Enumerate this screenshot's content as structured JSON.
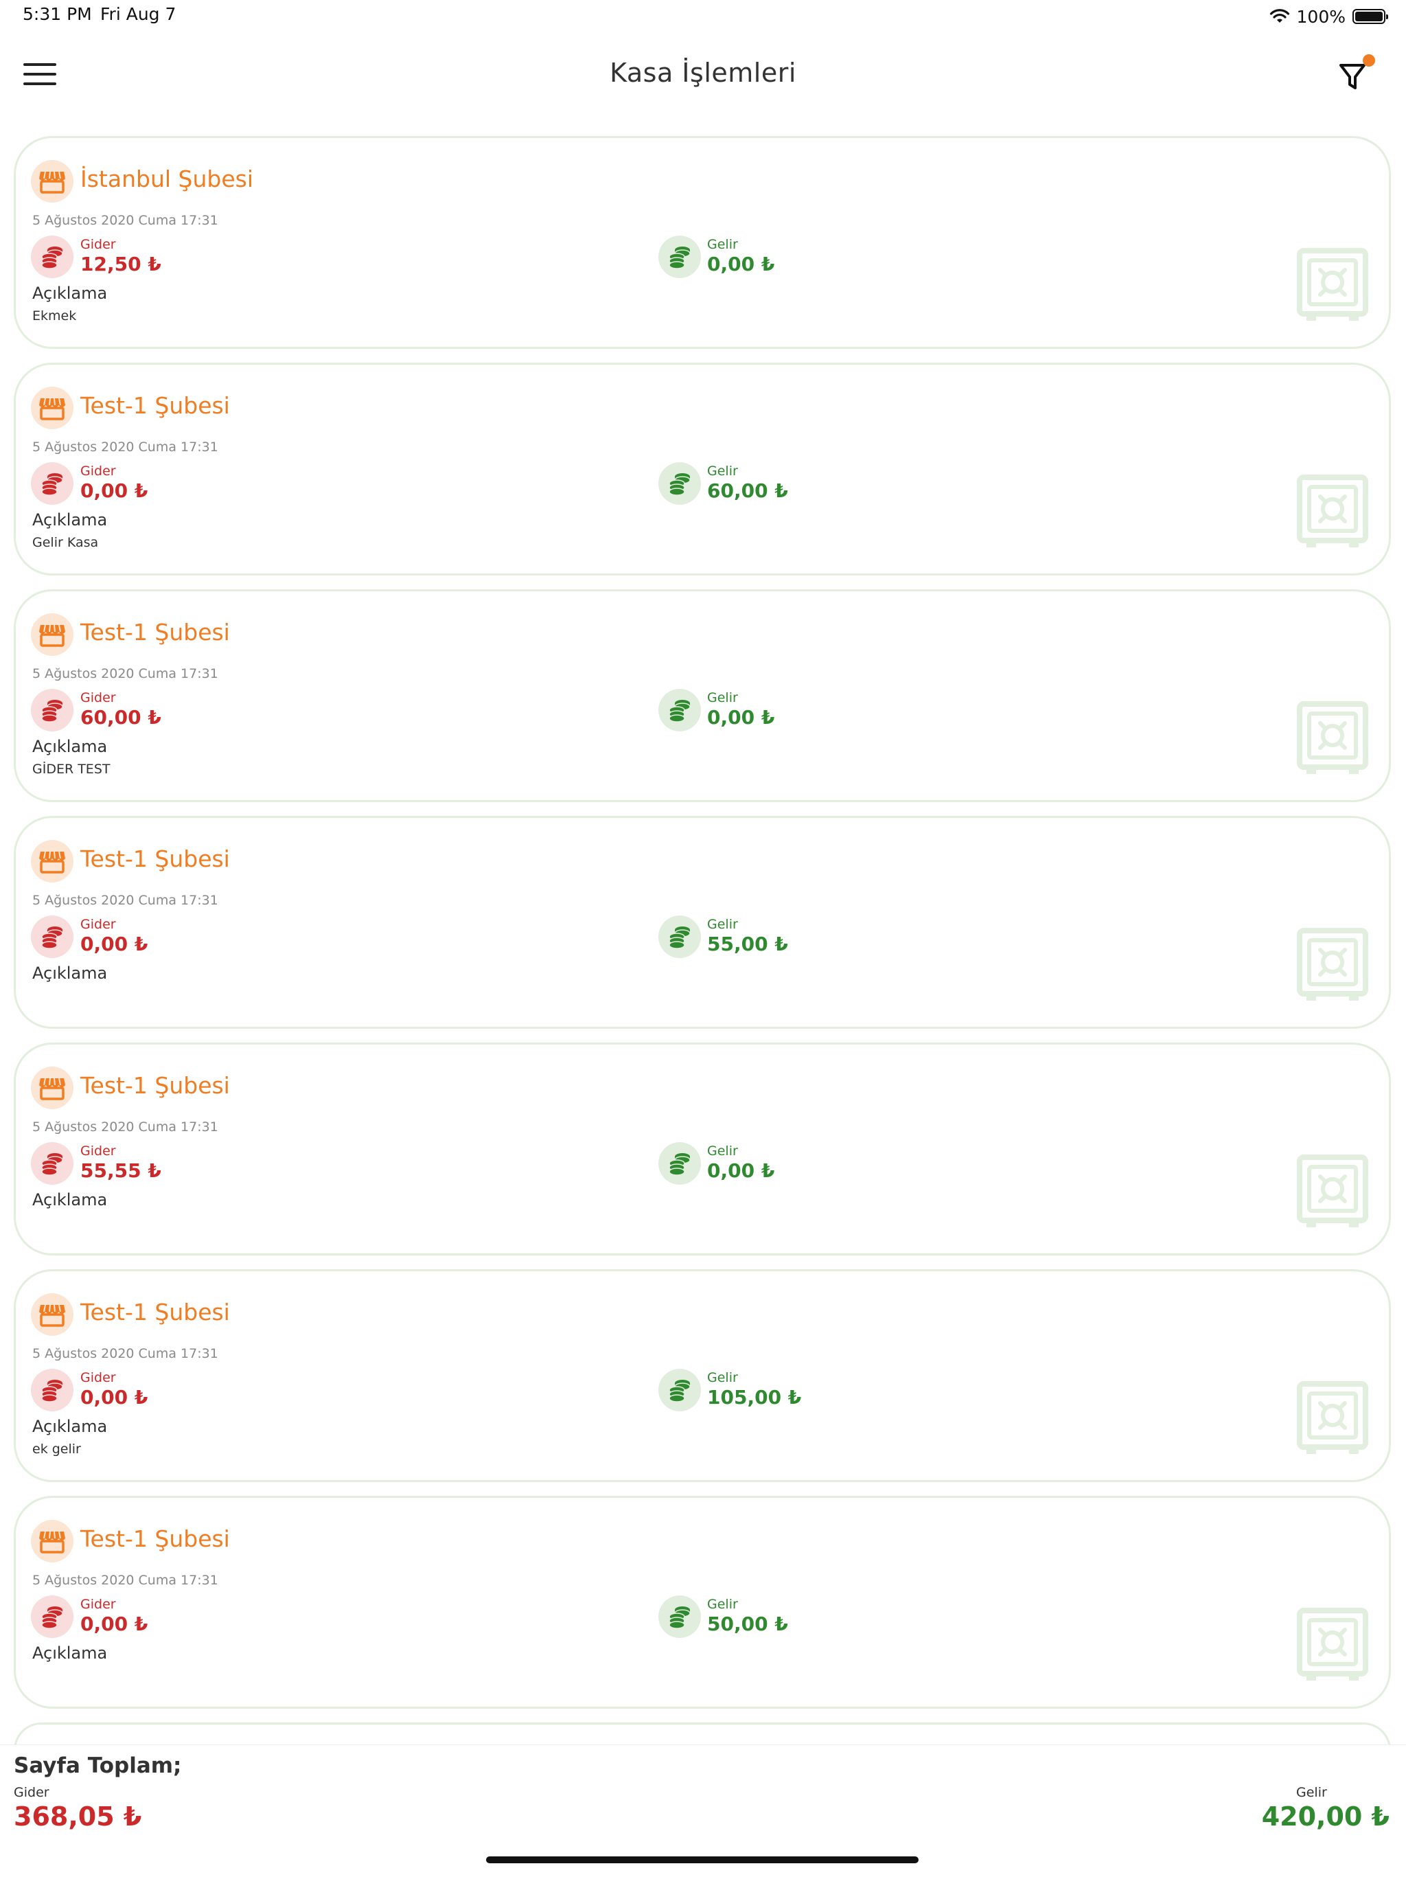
{
  "status_bar": {
    "time": "5:31 PM",
    "date": "Fri Aug 7",
    "battery": "100%"
  },
  "header": {
    "title": "Kasa İşlemleri"
  },
  "colors": {
    "accent": "#f07d22",
    "expense": "#cc2a2a",
    "income": "#2f8a2f",
    "card_border": "#e2efdf"
  },
  "records": [
    {
      "branch": "İstanbul Şubesi",
      "date": "5 Ağustos 2020 Cuma 17:31",
      "gider_label": "Gider",
      "gider": "12,50 ₺",
      "gelir_label": "Gelir",
      "gelir": "0,00 ₺",
      "desc_label": "Açıklama",
      "desc": "Ekmek"
    },
    {
      "branch": "Test-1 Şubesi",
      "date": "5 Ağustos 2020 Cuma 17:31",
      "gider_label": "Gider",
      "gider": "0,00 ₺",
      "gelir_label": "Gelir",
      "gelir": "60,00 ₺",
      "desc_label": "Açıklama",
      "desc": "Gelir Kasa"
    },
    {
      "branch": "Test-1 Şubesi",
      "date": "5 Ağustos 2020 Cuma 17:31",
      "gider_label": "Gider",
      "gider": "60,00 ₺",
      "gelir_label": "Gelir",
      "gelir": "0,00 ₺",
      "desc_label": "Açıklama",
      "desc": "GİDER TEST"
    },
    {
      "branch": "Test-1 Şubesi",
      "date": "5 Ağustos 2020 Cuma 17:31",
      "gider_label": "Gider",
      "gider": "0,00 ₺",
      "gelir_label": "Gelir",
      "gelir": "55,00 ₺",
      "desc_label": "Açıklama",
      "desc": ""
    },
    {
      "branch": "Test-1 Şubesi",
      "date": "5 Ağustos 2020 Cuma 17:31",
      "gider_label": "Gider",
      "gider": "55,55 ₺",
      "gelir_label": "Gelir",
      "gelir": "0,00 ₺",
      "desc_label": "Açıklama",
      "desc": ""
    },
    {
      "branch": "Test-1 Şubesi",
      "date": "5 Ağustos 2020 Cuma 17:31",
      "gider_label": "Gider",
      "gider": "0,00 ₺",
      "gelir_label": "Gelir",
      "gelir": "105,00 ₺",
      "desc_label": "Açıklama",
      "desc": "ek gelir"
    },
    {
      "branch": "Test-1 Şubesi",
      "date": "5 Ağustos 2020 Cuma 17:31",
      "gider_label": "Gider",
      "gider": "0,00 ₺",
      "gelir_label": "Gelir",
      "gelir": "50,00 ₺",
      "desc_label": "Açıklama",
      "desc": ""
    }
  ],
  "footer": {
    "title": "Sayfa Toplam;",
    "gider_label": "Gider",
    "gider_total": "368,05 ₺",
    "gelir_label": "Gelir",
    "gelir_total": "420,00 ₺"
  },
  "icons": {
    "menu": "hamburger-menu-icon",
    "filter": "filter-icon",
    "shop": "storefront-icon",
    "expense": "coins-stack-icon",
    "income": "coins-stack-icon",
    "safe": "safe-icon"
  }
}
